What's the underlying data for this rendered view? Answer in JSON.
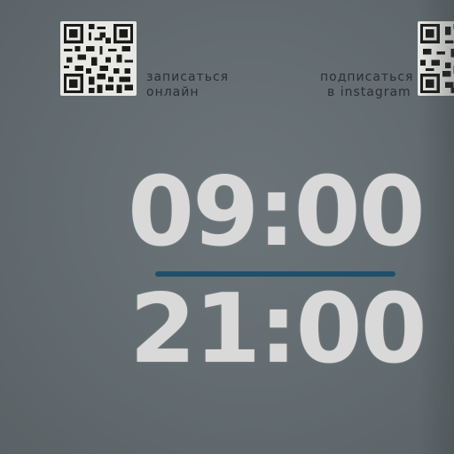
{
  "sign": {
    "qr_left": {
      "icon": "qr-code-icon",
      "caption_line1": "записаться",
      "caption_line2": "онлайн"
    },
    "qr_right": {
      "icon": "qr-code-icon",
      "caption_line1": "подписаться",
      "caption_line2": "в instagram"
    },
    "hours": {
      "open": "09:00",
      "close": "21:00"
    },
    "colors": {
      "background": "#646d71",
      "digits": "#d9d9d9",
      "divider": "#1f4f6b",
      "caption": "#2a2f32",
      "qr": "#e8e8e4"
    }
  }
}
